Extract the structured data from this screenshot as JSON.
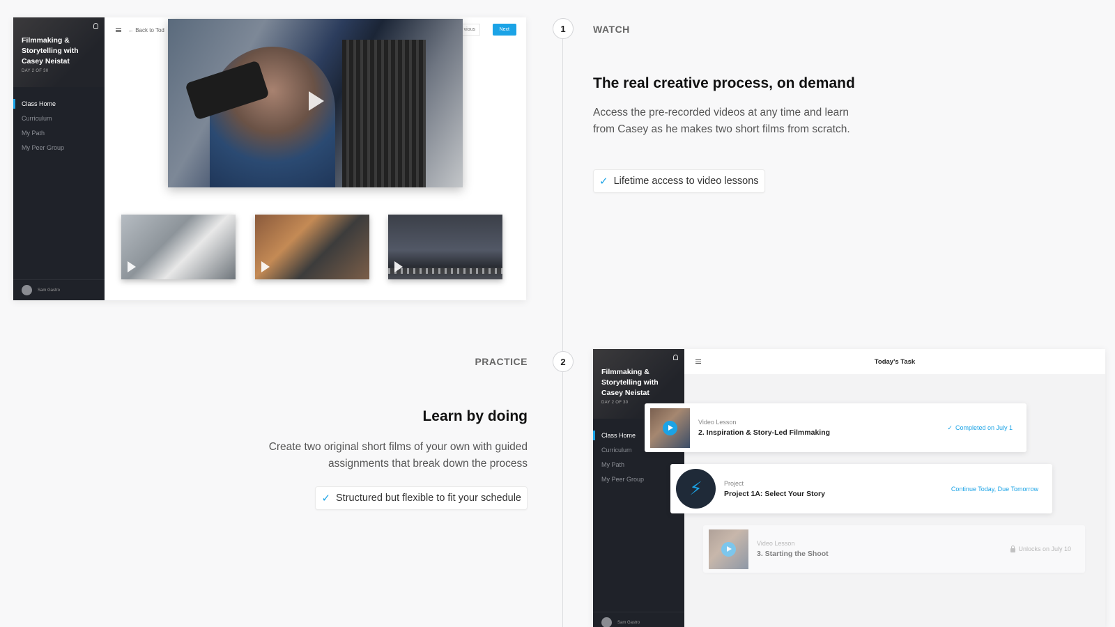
{
  "watch": {
    "step": "1",
    "label": "WATCH",
    "heading": "The real creative process, on demand",
    "description": "Access the pre-recorded videos at any time and learn from Casey as he makes two short films from scratch.",
    "check": "Lifetime access to video lessons"
  },
  "practice": {
    "step": "2",
    "label": "PRACTICE",
    "heading": "Learn by doing",
    "description": "Create two original short films of your own with guided assignments that break down the process",
    "check": "Structured but flexible to fit your schedule"
  },
  "app": {
    "course_title": "Filmmaking & Storytelling with Casey Neistat",
    "day": "DAY 2 OF 30",
    "nav": [
      "Class Home",
      "Curriculum",
      "My Path",
      "My Peer Group"
    ],
    "user": "Sam Gastro",
    "back": "← Back to Tod",
    "previous": "vious",
    "next": "Next",
    "todays_task": "Today's Task"
  },
  "tasks": [
    {
      "kind": "Video Lesson",
      "name": "2. Inspiration & Story-Led Filmmaking",
      "status": "Completed on July 1"
    },
    {
      "kind": "Project",
      "name": "Project 1A: Select Your Story",
      "status": "Continue Today, Due Tomorrow"
    },
    {
      "kind": "Video Lesson",
      "name": "3. Starting the Shoot",
      "status": "Unlocks on July 10"
    }
  ],
  "colors": {
    "accent": "#1ba3e6",
    "sidebar": "#1f2229"
  }
}
